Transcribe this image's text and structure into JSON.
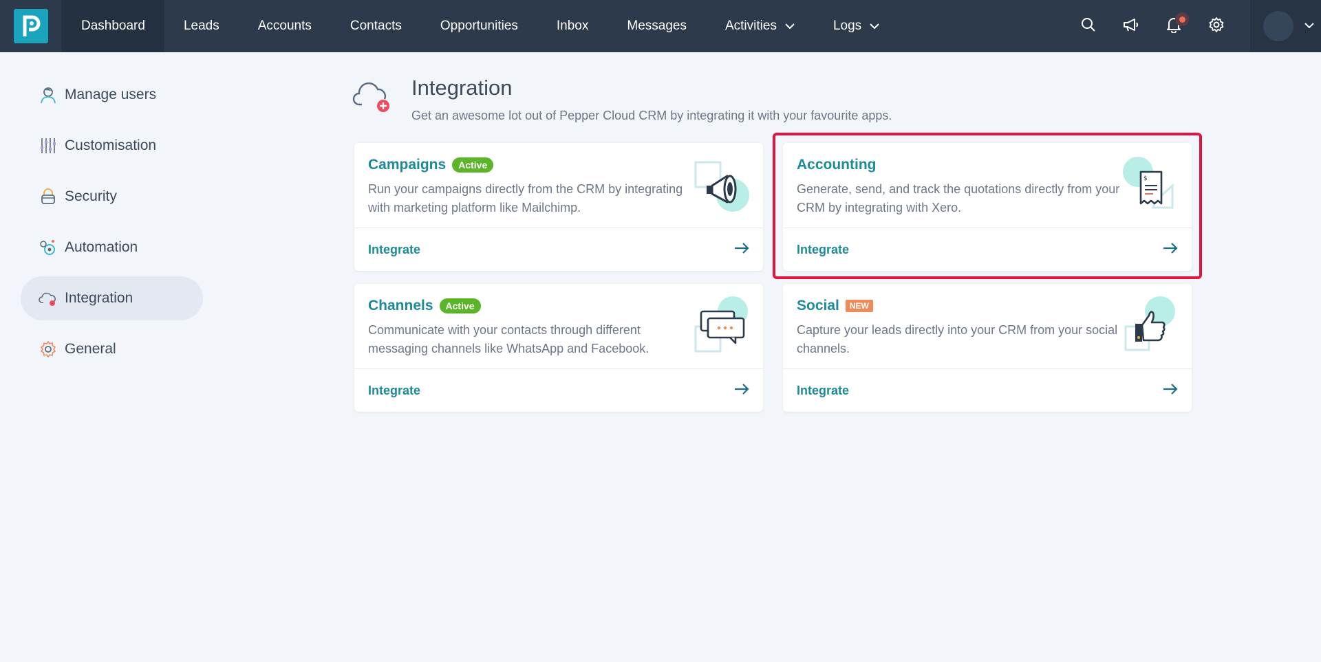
{
  "nav": {
    "items": [
      {
        "label": "Dashboard"
      },
      {
        "label": "Leads"
      },
      {
        "label": "Accounts"
      },
      {
        "label": "Contacts"
      },
      {
        "label": "Opportunities"
      },
      {
        "label": "Inbox"
      },
      {
        "label": "Messages"
      },
      {
        "label": "Activities"
      },
      {
        "label": "Logs"
      }
    ],
    "active": "Dashboard"
  },
  "sidebar": {
    "items": [
      {
        "label": "Manage users",
        "icon": "user-icon"
      },
      {
        "label": "Customisation",
        "icon": "sliders-icon"
      },
      {
        "label": "Security",
        "icon": "lock-icon"
      },
      {
        "label": "Automation",
        "icon": "automation-icon"
      },
      {
        "label": "Integration",
        "icon": "cloud-icon"
      },
      {
        "label": "General",
        "icon": "gear-icon"
      }
    ],
    "active": "Integration"
  },
  "header": {
    "title": "Integration",
    "subtitle": "Get an awesome lot out of Pepper Cloud CRM by integrating it with your favourite apps."
  },
  "cards": [
    {
      "title": "Campaigns",
      "badge": "Active",
      "desc": "Run your campaigns directly from the CRM by integrating with marketing platform like Mailchimp.",
      "action": "Integrate",
      "icon": "megaphone-icon"
    },
    {
      "title": "Accounting",
      "badge": "",
      "desc": "Generate, send, and track the quotations directly from your CRM by integrating with Xero.",
      "action": "Integrate",
      "icon": "invoice-icon"
    },
    {
      "title": "Channels",
      "badge": "Active",
      "desc": "Communicate with your contacts through different messaging channels like WhatsApp and Facebook.",
      "action": "Integrate",
      "icon": "chat-bubbles-icon"
    },
    {
      "title": "Social",
      "badge": "NEW",
      "desc": "Capture your leads directly into your CRM from your social channels.",
      "action": "Integrate",
      "icon": "thumbs-up-icon"
    }
  ],
  "colors": {
    "topbar": "#2c3a4b",
    "brand": "#1aa3bd",
    "accent_text": "#1c8a9b",
    "active_badge": "#5bb528",
    "new_badge": "#ef8a5a",
    "highlight": "#e0163e"
  }
}
